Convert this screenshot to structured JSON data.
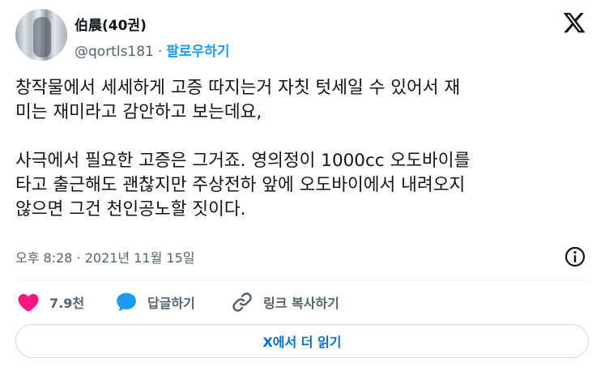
{
  "author": {
    "name": "伯晨(40권)",
    "handle": "@qortls181",
    "separator": "·",
    "follow_label": "팔로우하기"
  },
  "tweet": {
    "paragraph1": [
      "창작물에서 세세하게 고증 따지는거 자칫 텃세일 수 있어서 재",
      "미는 재미라고 감안하고 보는데요,"
    ],
    "paragraph2": [
      "사극에서 필요한 고증은 그거죠. 영의정이 1000cc 오도바이를",
      "타고 출근해도 괜찮지만 주상전하 앞에 오도바이에서 내려오지",
      "않으면 그건 천인공노할 짓이다."
    ],
    "timestamp": "오후 8:28 · 2021년 11월 15일"
  },
  "actions": {
    "like_count": "7.9천",
    "reply_label": "답글하기",
    "copy_label": "링크 복사하기"
  },
  "read_more_label": "X에서 더 읽기",
  "colors": {
    "like": "#f91880",
    "reply": "#1d9bf0",
    "link": "#006fd6",
    "secondary_text": "#536471"
  },
  "icons": [
    "x-logo-icon",
    "info-icon",
    "heart-icon",
    "speech-bubble-icon",
    "link-icon"
  ]
}
